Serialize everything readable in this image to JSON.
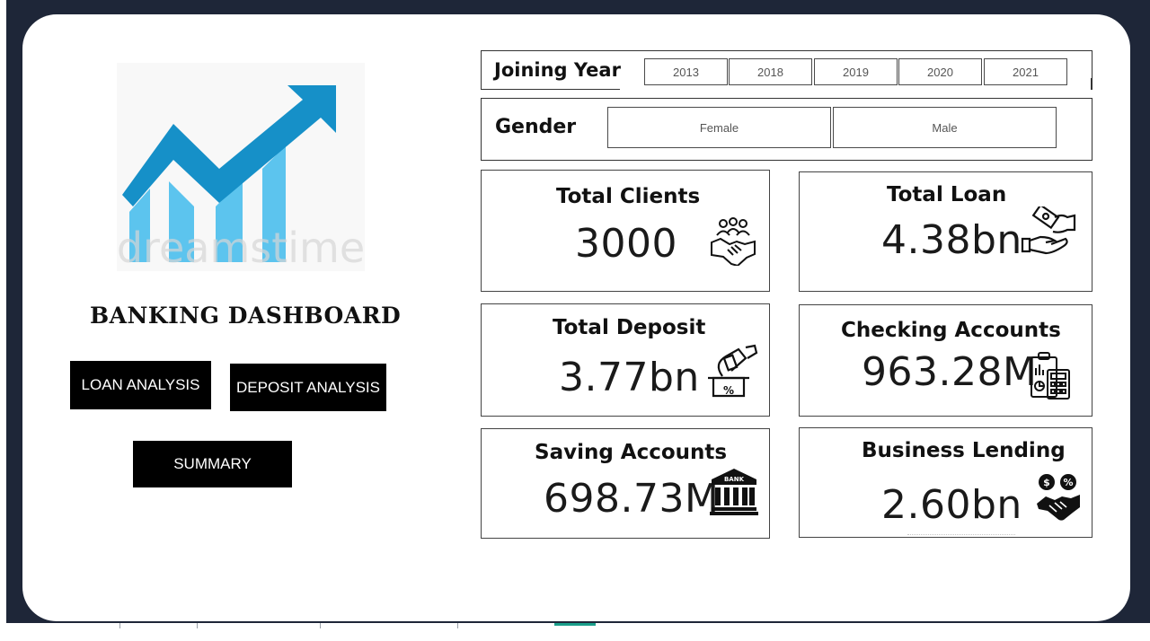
{
  "app": {
    "title": "BANKING DASHBOARD",
    "logo_watermark": "dreamstime"
  },
  "nav": {
    "loan_label": "LOAN ANALYSIS",
    "deposit_label": "DEPOSIT ANALYSIS",
    "summary_label": "SUMMARY"
  },
  "filters": {
    "year": {
      "label": "Joining Year",
      "options": [
        "2013",
        "2018",
        "2019",
        "2020",
        "2021"
      ]
    },
    "gender": {
      "label": "Gender",
      "options": [
        "Female",
        "Male"
      ]
    }
  },
  "kpis": {
    "total_clients": {
      "label": "Total Clients",
      "value": "3000",
      "icon": "clients-handshake-icon"
    },
    "total_loan": {
      "label": "Total Loan",
      "value": "4.38bn",
      "icon": "loan-hand-money-icon"
    },
    "total_deposit": {
      "label": "Total Deposit",
      "value": "3.77bn",
      "icon": "deposit-box-icon"
    },
    "checking_accounts": {
      "label": "Checking Accounts",
      "value": "963.28M",
      "icon": "calculator-clipboard-icon"
    },
    "saving_accounts": {
      "label": "Saving Accounts",
      "value": "698.73M",
      "icon": "bank-building-icon"
    },
    "business_lending": {
      "label": "Business Lending",
      "value": "2.60bn",
      "icon": "business-handshake-icon"
    }
  },
  "colors": {
    "frame": "#1e2638",
    "canvas": "#ffffff",
    "button_bg": "#000000",
    "button_text": "#ffffff",
    "logo_arrow": "#1690c8",
    "logo_bars": "#5cc4ee"
  }
}
